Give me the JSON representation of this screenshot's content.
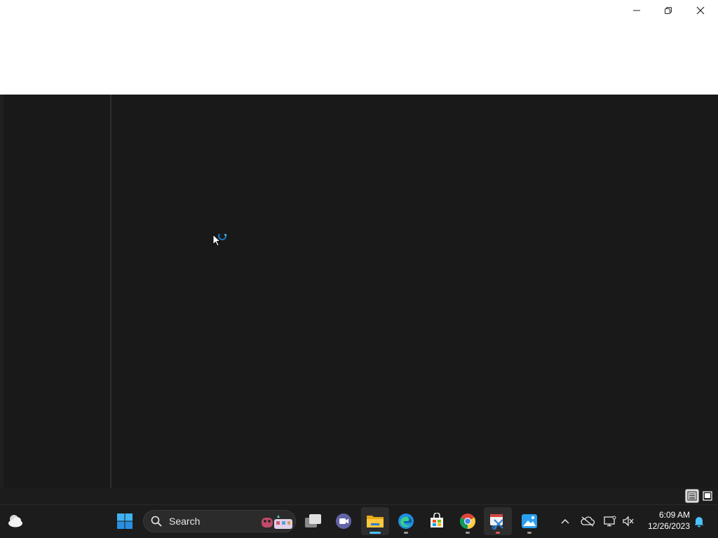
{
  "window": {
    "caption": {
      "minimize_icon": "minimize-icon",
      "restore_icon": "restore-icon",
      "close_icon": "close-icon"
    },
    "loading_icon": "busy-spinner-icon",
    "status_bar": {
      "details_view_icon": "details-view-icon",
      "large_icons_view_icon": "large-icons-view-icon"
    }
  },
  "taskbar": {
    "widgets_icon": "weather-cloud-icon",
    "start_icon": "windows-start-icon",
    "search": {
      "label": "Search",
      "icon": "search-icon"
    },
    "apps": [
      {
        "name": "task-view-icon",
        "state": "idle"
      },
      {
        "name": "teams-meet-icon",
        "state": "idle"
      },
      {
        "name": "file-explorer-icon",
        "state": "active"
      },
      {
        "name": "edge-icon",
        "state": "running"
      },
      {
        "name": "microsoft-store-icon",
        "state": "idle"
      },
      {
        "name": "chrome-icon",
        "state": "running"
      },
      {
        "name": "snipping-tool-icon",
        "state": "running-attention"
      },
      {
        "name": "photos-icon",
        "state": "running"
      }
    ],
    "tray": {
      "overflow_icon": "chevron-up-icon",
      "onedrive_icon": "onedrive-offline-icon",
      "network_icon": "network-icon",
      "volume_icon": "volume-muted-icon",
      "notification_icon": "notification-bell-icon"
    },
    "clock": {
      "time": "6:09 AM",
      "date": "12/26/2023"
    }
  },
  "colors": {
    "accent": "#4cc2ff",
    "window_bg": "#191919",
    "titlebar_bg": "#ffffff",
    "taskbar_bg": "#1c1c1c"
  }
}
